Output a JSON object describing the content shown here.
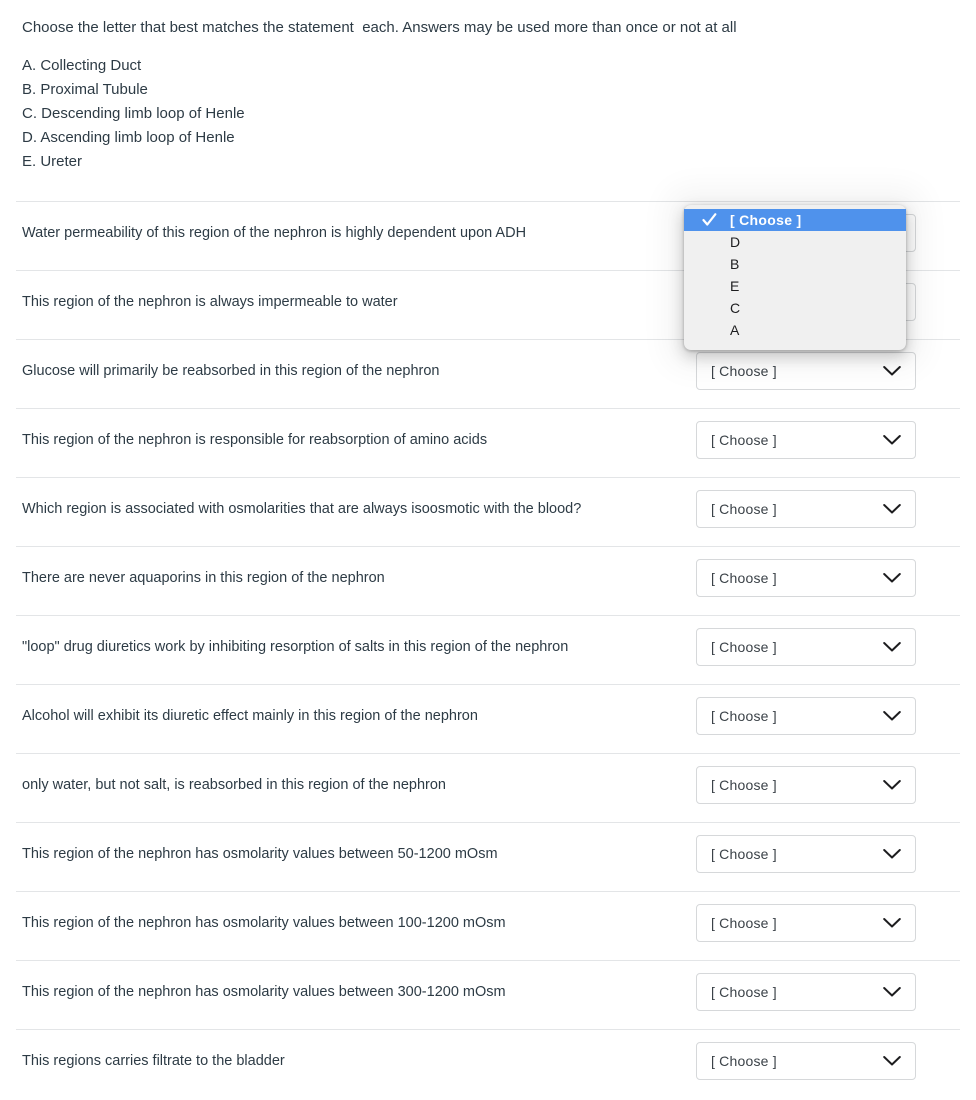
{
  "quiz": {
    "prompt": "Choose the letter that best matches the statement  each. Answers may be used more than once or not at all",
    "answer_key": [
      "A. Collecting Duct",
      "B. Proximal Tubule",
      "C. Descending limb loop of Henle",
      "D. Ascending limb loop of Henle",
      "E. Ureter"
    ],
    "select_placeholder": "[ Choose ]",
    "questions": [
      {
        "text": "Water permeability of this region of the nephron is highly dependent upon ADH",
        "value": "[ Choose ]"
      },
      {
        "text": "This region of the nephron is always impermeable to water",
        "value": "[ Choose ]"
      },
      {
        "text": "Glucose will primarily be reabsorbed in this region of the nephron",
        "value": "[ Choose ]"
      },
      {
        "text": "This region of the nephron is responsible for reabsorption of amino acids",
        "value": "[ Choose ]"
      },
      {
        "text": "Which region is associated with osmolarities that are always isoosmotic with the blood?",
        "value": "[ Choose ]"
      },
      {
        "text": "There are never aquaporins in this region of the nephron",
        "value": "[ Choose ]"
      },
      {
        "text": "\"loop\" drug diuretics work by inhibiting resorption of salts in this region of the nephron",
        "value": "[ Choose ]"
      },
      {
        "text": "Alcohol will exhibit its diuretic effect mainly in this region of the nephron",
        "value": "[ Choose ]"
      },
      {
        "text": "only water, but not salt, is reabsorbed in this region of the nephron",
        "value": "[ Choose ]"
      },
      {
        "text": "This region of the nephron has osmolarity values between 50-1200 mOsm",
        "value": "[ Choose ]"
      },
      {
        "text": "This region of the nephron has osmolarity values between 100-1200 mOsm",
        "value": "[ Choose ]"
      },
      {
        "text": "This region of the nephron has osmolarity values between 300-1200 mOsm",
        "value": "[ Choose ]"
      },
      {
        "text": "This regions carries filtrate to the bladder",
        "value": "[ Choose ]"
      }
    ]
  },
  "dropdown": {
    "open": true,
    "anchored_to_question_index": 0,
    "selected_option": "[ Choose ]",
    "options": [
      {
        "label": "[ Choose ]",
        "selected": true
      },
      {
        "label": "D",
        "selected": false
      },
      {
        "label": "B",
        "selected": false
      },
      {
        "label": "E",
        "selected": false
      },
      {
        "label": "C",
        "selected": false
      },
      {
        "label": "A",
        "selected": false
      }
    ]
  },
  "colors": {
    "selection_blue": "#4f92ec",
    "popup_background": "#f0f0f0",
    "text": "#2d3b45",
    "separator": "#e3e5e7",
    "select_border": "#d6d8da"
  },
  "icons": {
    "chevron_down": "chevron-down-icon",
    "check": "check-icon"
  }
}
